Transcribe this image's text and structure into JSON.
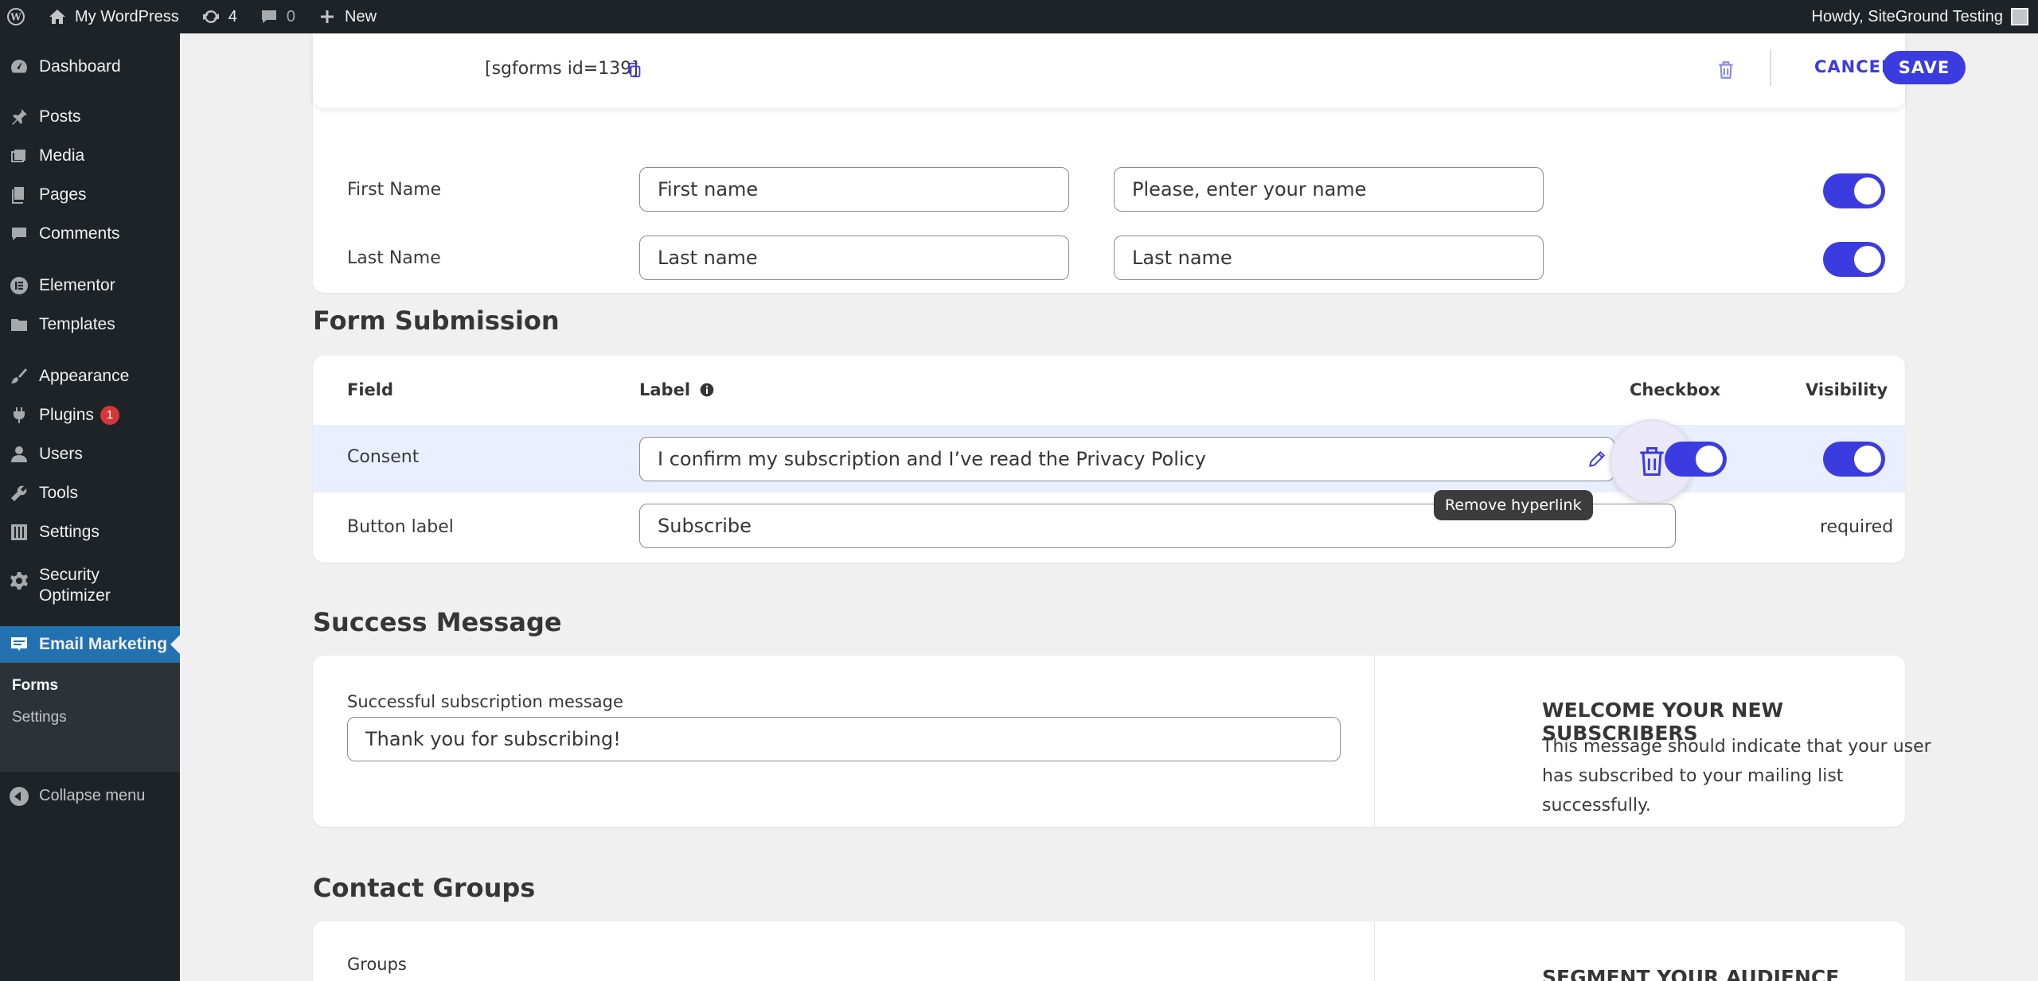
{
  "admin_bar": {
    "site_name": "My WordPress",
    "updates_count": "4",
    "comments_count": "0",
    "new_label": "New",
    "greeting": "Howdy, SiteGround Testing"
  },
  "sidebar": {
    "items": [
      {
        "label": "Dashboard"
      },
      {
        "label": "Posts"
      },
      {
        "label": "Media"
      },
      {
        "label": "Pages"
      },
      {
        "label": "Comments"
      },
      {
        "label": "Elementor"
      },
      {
        "label": "Templates"
      },
      {
        "label": "Appearance"
      },
      {
        "label": "Plugins",
        "badge": "1"
      },
      {
        "label": "Users"
      },
      {
        "label": "Tools"
      },
      {
        "label": "Settings"
      },
      {
        "label": "Security Optimizer"
      },
      {
        "label": "Email Marketing"
      }
    ],
    "submenu": [
      "Forms",
      "Settings"
    ],
    "collapse_label": "Collapse menu"
  },
  "toolbar": {
    "shortcode": "[sgforms id=139]",
    "cancel_label": "CANCEL",
    "save_label": "SAVE"
  },
  "fields": {
    "rows": [
      {
        "name": "First Name",
        "label_value": "First name",
        "placeholder_value": "Please, enter your name",
        "visible": true
      },
      {
        "name": "Last Name",
        "label_value": "Last name",
        "placeholder_value": "Last name",
        "visible": true
      }
    ]
  },
  "form_submission": {
    "title": "Form Submission",
    "headers": {
      "field": "Field",
      "label": "Label",
      "checkbox": "Checkbox",
      "visibility": "Visibility"
    },
    "consent": {
      "name": "Consent",
      "value": "I confirm my subscription and I’ve read the Privacy Policy",
      "checkbox": true,
      "visible": true
    },
    "button": {
      "name": "Button label",
      "value": "Subscribe",
      "visibility_text": "required"
    },
    "tooltip": "Remove hyperlink"
  },
  "success": {
    "title": "Success Message",
    "field_label": "Successful subscription message",
    "value": "Thank you for subscribing!",
    "aside_title": "WELCOME YOUR NEW SUBSCRIBERS",
    "aside_text": "This message should indicate that your user has subscribed to your mailing list successfully."
  },
  "contact_groups": {
    "title": "Contact Groups",
    "field_label": "Groups",
    "aside_title": "SEGMENT YOUR AUDIENCE"
  },
  "colors": {
    "accent": "#3b3ce0",
    "wp_admin_dark": "#1d2327",
    "wp_blue": "#2271b1",
    "highlight_row": "#eaefff"
  }
}
